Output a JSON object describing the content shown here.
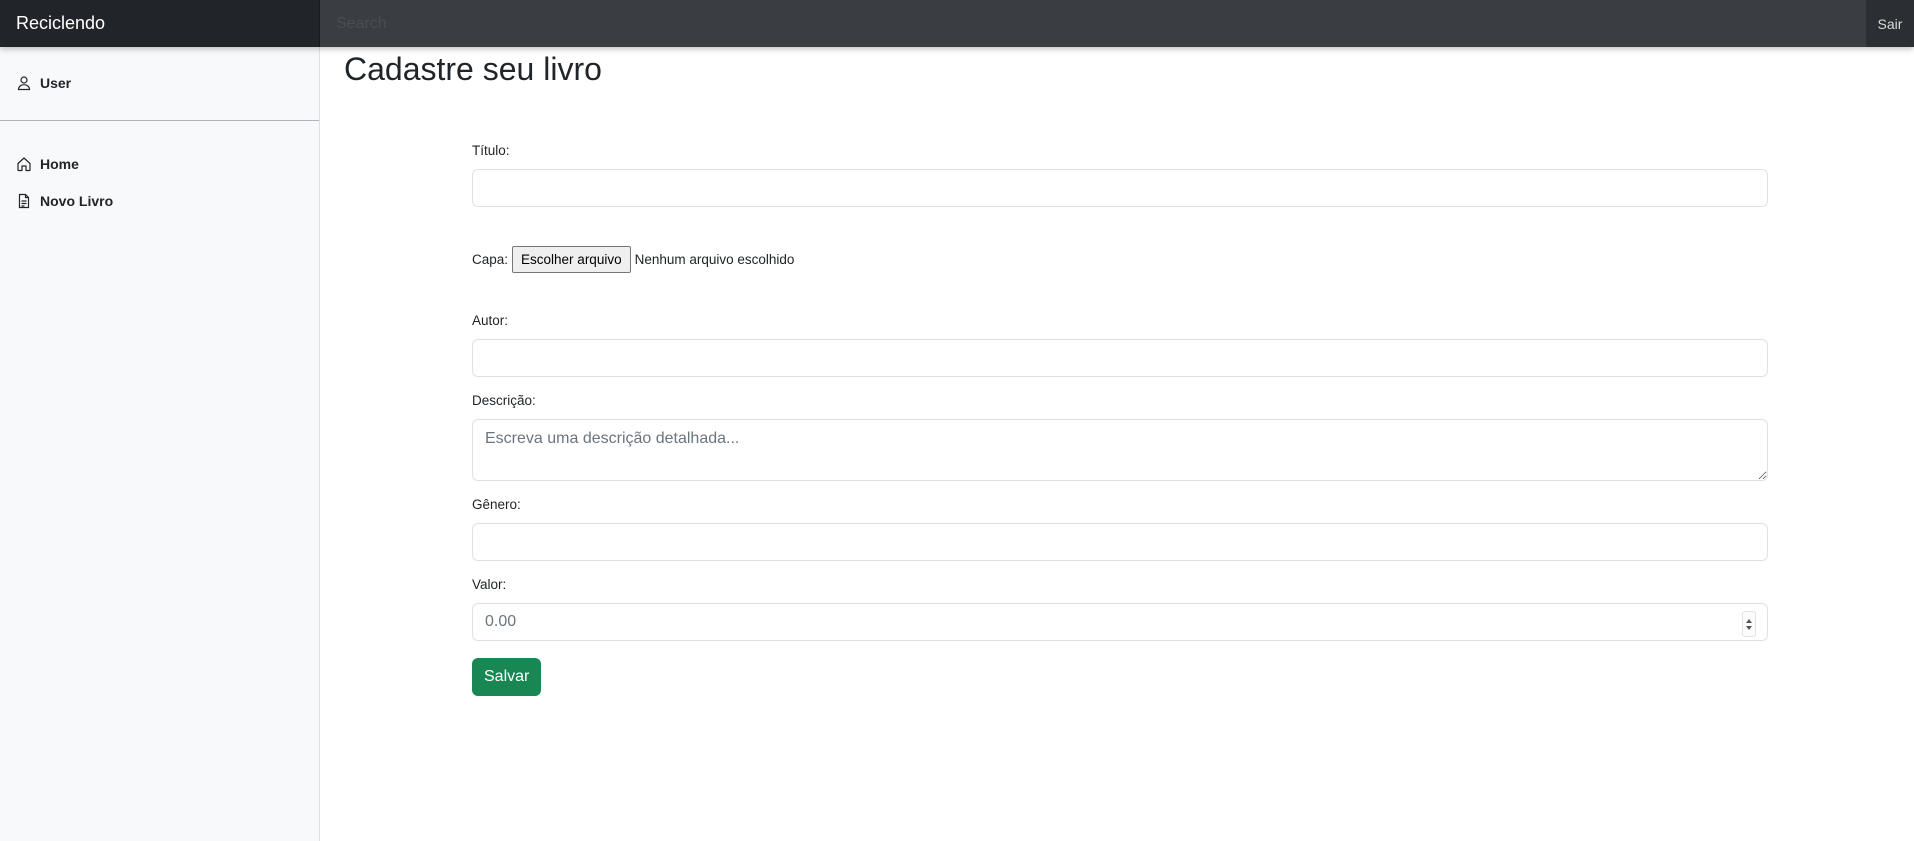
{
  "navbar": {
    "brand": "Reciclendo",
    "search_placeholder": "Search",
    "signout_label": "Sair"
  },
  "sidebar": {
    "user_label": "User",
    "items": [
      {
        "label": "Home",
        "icon": "house-icon"
      },
      {
        "label": "Novo Livro",
        "icon": "file-icon"
      }
    ]
  },
  "main": {
    "title": "Cadastre seu livro",
    "form": {
      "titulo_label": "Título:",
      "capa_label": "Capa:",
      "capa_button": "Escolher arquivo",
      "capa_status": "Nenhum arquivo escolhido",
      "autor_label": "Autor:",
      "descricao_label": "Descrição:",
      "descricao_placeholder": "Escreva uma descrição detalhada...",
      "genero_label": "Gênero:",
      "valor_label": "Valor:",
      "valor_placeholder": "0.00",
      "save_label": "Salvar"
    }
  },
  "colors": {
    "navbar_bg": "#3a3d42",
    "brand_bg": "#212529",
    "sidebar_bg": "#f8f9fa",
    "save_button": "#198754"
  }
}
